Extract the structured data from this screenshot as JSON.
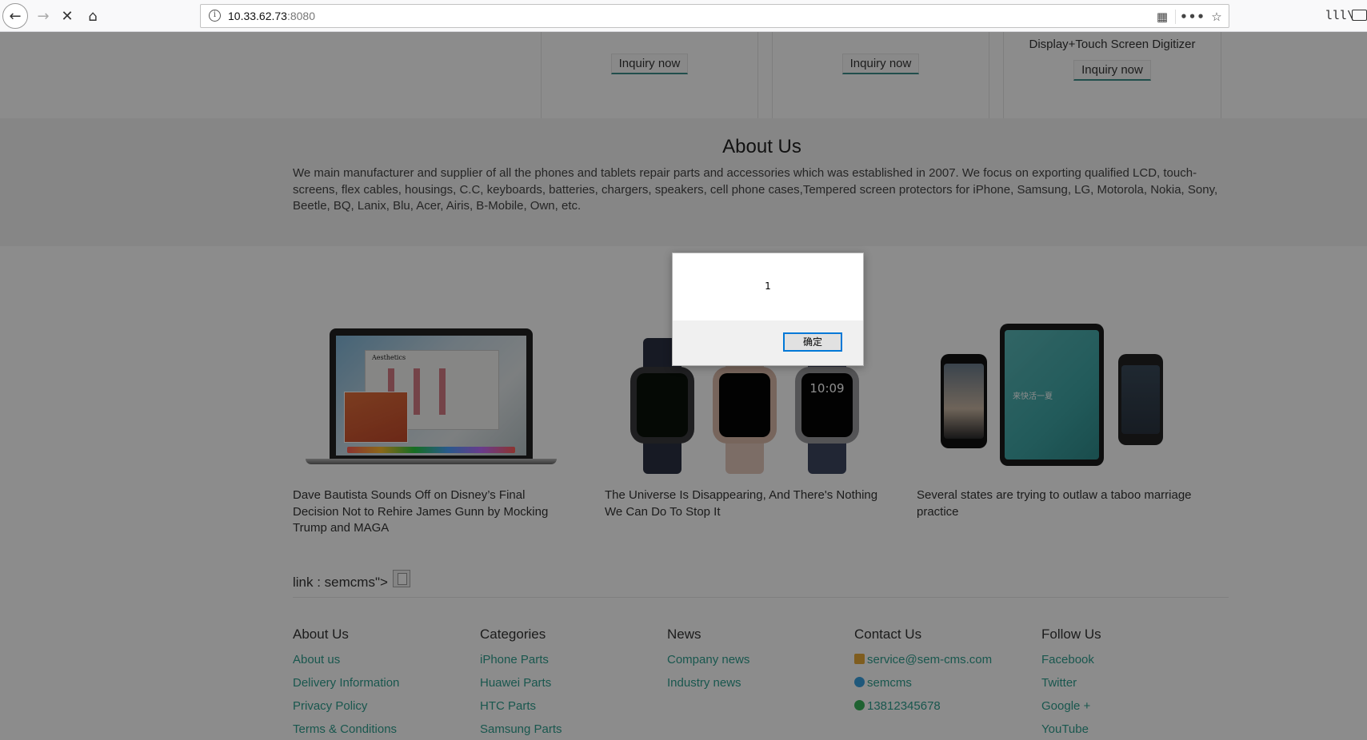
{
  "browser": {
    "url_host": "10.33.62.73",
    "url_port": ":8080",
    "back_glyph": "←",
    "forward_glyph": "→",
    "stop_glyph": "✕",
    "home_glyph": "⌂",
    "info_glyph": "i",
    "qr_glyph": "▦",
    "more_glyph": "•••",
    "star_glyph": "☆",
    "library_glyph": "lll\\"
  },
  "products": [
    {
      "desc": "",
      "button": "Inquiry now"
    },
    {
      "desc": "",
      "button": "Inquiry now"
    },
    {
      "desc": "Display+Touch Screen Digitizer",
      "button": "Inquiry now"
    }
  ],
  "about": {
    "title": "About Us",
    "text": "We main manufacturer and supplier of all the phones and tablets repair parts and accessories which was established in 2007. We focus on exporting qualified LCD, touch-screens, flex cables, housings, C.C, keyboards, batteries, chargers, speakers, cell phone cases,Tempered screen protectors for iPhone, Samsung, LG, Motorola, Nokia, Sony, Beetle, BQ, Lanix, Blu, Acer, Airis, B-Mobile, Own, etc."
  },
  "news": [
    {
      "title": "Dave Bautista Sounds Off on Disney’s Final Decision Not to Rehire James Gunn by Mocking Trump and MAGA"
    },
    {
      "title": "The Universe Is Disappearing, And There's Nothing We Can Do To Stop It"
    },
    {
      "title": "Several states are trying to outlaw a taboo marriage practice"
    }
  ],
  "news_images": {
    "laptop_app_title": "Aesthetics",
    "watch_1": "",
    "watch_2": "",
    "watch_3": "10:09",
    "tablet_text": "来快活一夏"
  },
  "link_row": {
    "text": "link : semcms\">"
  },
  "footer": {
    "about": {
      "heading": "About Us",
      "links": [
        "About us",
        "Delivery Information",
        "Privacy Policy",
        "Terms & Conditions"
      ]
    },
    "categories": {
      "heading": "Categories",
      "links": [
        "iPhone Parts",
        "Huawei Parts",
        "HTC Parts",
        "Samsung Parts"
      ]
    },
    "news": {
      "heading": "News",
      "links": [
        "Company news",
        "Industry news"
      ]
    },
    "contact": {
      "heading": "Contact Us",
      "email": "service@sem-cms.com",
      "skype": "semcms",
      "phone": "13812345678"
    },
    "follow": {
      "heading": "Follow Us",
      "links": [
        "Facebook",
        "Twitter",
        "Google +",
        "YouTube"
      ]
    }
  },
  "dialog": {
    "message": "1",
    "ok_label": "确定"
  },
  "colors": {
    "accent": "#2f9e8f",
    "overlay": "rgba(0,0,0,0.45)",
    "dialog_border": "#0078d7"
  }
}
